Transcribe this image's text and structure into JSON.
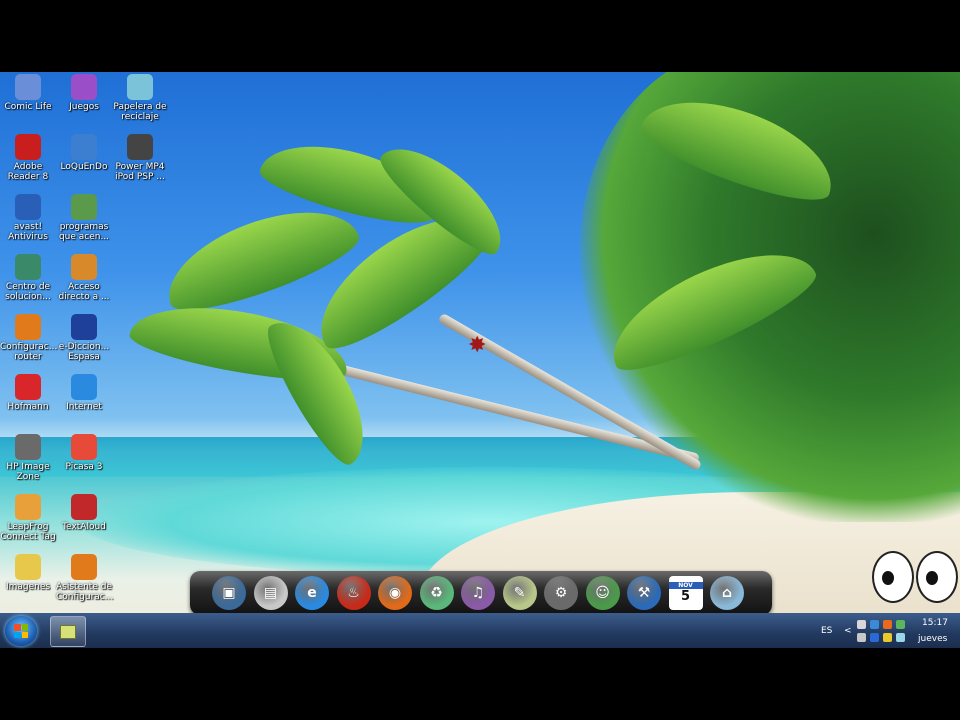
{
  "desktop": {
    "icons": [
      {
        "label": "Comic Life",
        "icon": "comic-life-icon",
        "color": "#6a8fd8"
      },
      {
        "label": "Juegos",
        "icon": "games-icon",
        "color": "#9a4fc8"
      },
      {
        "label": "Papelera de reciclaje",
        "icon": "recycle-bin-icon",
        "color": "#7ac3d8"
      },
      {
        "label": "Adobe Reader 8",
        "icon": "adobe-reader-icon",
        "color": "#c81e1e"
      },
      {
        "label": "LoQuEnDo",
        "icon": "loquendo-icon",
        "color": "#3c7fd0"
      },
      {
        "label": "Power MP4 iPod PSP ...",
        "icon": "film-reel-icon",
        "color": "#444444"
      },
      {
        "label": "avast! Antivirus",
        "icon": "avast-icon",
        "color": "#2a5fb8"
      },
      {
        "label": "programas que acen...",
        "icon": "programs-icon",
        "color": "#5a9a4a"
      },
      {
        "label": "Centro de solucion...",
        "icon": "solution-center-icon",
        "color": "#3a8a6a"
      },
      {
        "label": "Acceso directo a ...",
        "icon": "shortcut-icon",
        "color": "#d88a2a"
      },
      {
        "label": "Configurac... router",
        "icon": "router-config-icon",
        "color": "#e07a1a"
      },
      {
        "label": "e-Diccion... Espasa",
        "icon": "dictionary-icon",
        "color": "#1e3f9a"
      },
      {
        "label": "Hofmann",
        "icon": "hofmann-icon",
        "color": "#d8262a"
      },
      {
        "label": "Internet",
        "icon": "internet-explorer-icon",
        "color": "#2a8ae0"
      },
      {
        "label": "HP Image Zone",
        "icon": "hp-image-zone-icon",
        "color": "#6a6a6a"
      },
      {
        "label": "Picasa 3",
        "icon": "picasa-icon",
        "color": "#e84a3a"
      },
      {
        "label": "LeapFrog Connect Tag",
        "icon": "leapfrog-icon",
        "color": "#e8a03a"
      },
      {
        "label": "TextAloud",
        "icon": "textaloud-icon",
        "color": "#c0282a"
      },
      {
        "label": "Imagenes",
        "icon": "images-folder-icon",
        "color": "#e8c84a"
      },
      {
        "label": "Asistente de Configurac...",
        "icon": "setup-wizard-icon",
        "color": "#e07a1a"
      }
    ]
  },
  "dock": {
    "items": [
      {
        "name": "dock-photo-viewer",
        "icon": "photo-viewer-icon",
        "color": "#3a6a9a",
        "glyph": "▣"
      },
      {
        "name": "dock-documents",
        "icon": "documents-icon",
        "color": "#c8c8c8",
        "glyph": "▤"
      },
      {
        "name": "dock-internet-explorer",
        "icon": "internet-explorer-icon",
        "color": "#2a8ae0",
        "glyph": "e"
      },
      {
        "name": "dock-burner",
        "icon": "flame-icon",
        "color": "#c82a1a",
        "glyph": "♨"
      },
      {
        "name": "dock-firefox",
        "icon": "firefox-icon",
        "color": "#e06a1a",
        "glyph": "◉"
      },
      {
        "name": "dock-recycle-bin",
        "icon": "recycle-bin-icon",
        "color": "#5ab87a",
        "glyph": "♻"
      },
      {
        "name": "dock-media-player",
        "icon": "music-icon",
        "color": "#8a5aa8",
        "glyph": "♫"
      },
      {
        "name": "dock-notes",
        "icon": "notes-icon",
        "color": "#b8c88a",
        "glyph": "✎"
      },
      {
        "name": "dock-settings",
        "icon": "gear-icon",
        "color": "#6a6a6a",
        "glyph": "⚙"
      },
      {
        "name": "dock-messenger",
        "icon": "messenger-icon",
        "color": "#4a9a4a",
        "glyph": "☺"
      },
      {
        "name": "dock-tools",
        "icon": "tools-icon",
        "color": "#2a6ab8",
        "glyph": "⚒"
      },
      {
        "name": "dock-calendar",
        "icon": "calendar-icon",
        "color": "#ffffff",
        "glyph": "5"
      },
      {
        "name": "dock-drive",
        "icon": "drive-icon",
        "color": "#8ab8d8",
        "glyph": "⌂"
      }
    ],
    "calendar_month": "NOV",
    "calendar_day": "5"
  },
  "taskbar": {
    "language": "ES",
    "tray_chevron": "<",
    "time": "15:17",
    "day": "jueves"
  },
  "colors": {
    "taskbar": "#22395f",
    "start_orb": "#1d5fb3"
  }
}
